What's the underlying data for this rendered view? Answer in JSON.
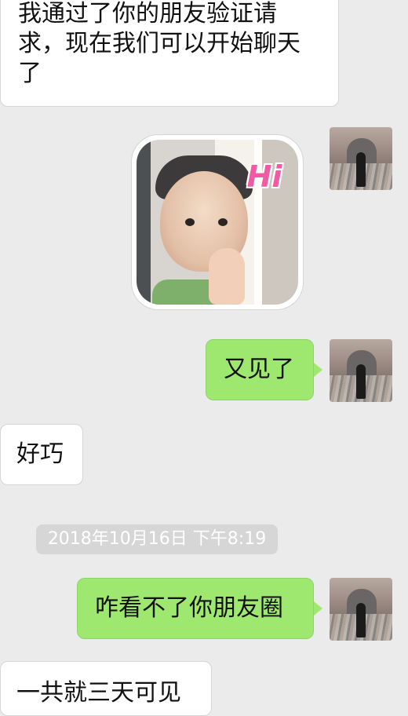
{
  "messages": [
    {
      "side": "left",
      "text": "我通过了你的朋友验证请求，现在我们可以开始聊天了",
      "lines": [
        "我通过了你的朋友验证请",
        "求，现在我们可以开始聊天",
        "了"
      ]
    },
    {
      "side": "right",
      "type": "sticker",
      "sticker_text": "Hi"
    },
    {
      "side": "right",
      "text": "又见了"
    },
    {
      "side": "left",
      "text": "好巧"
    },
    {
      "side": "right",
      "text": "咋看不了你朋友圈"
    },
    {
      "side": "left",
      "text": "一共就三天可见"
    }
  ],
  "timestamp": "2018年10月16日 下午8:19",
  "colors": {
    "background": "#ebebeb",
    "outgoing_bubble": "#9fe870",
    "incoming_bubble": "#ffffff",
    "timestamp_bg": "#d6d6d6"
  },
  "icons": {
    "sender_avatar": "avatar-person-doorway"
  }
}
